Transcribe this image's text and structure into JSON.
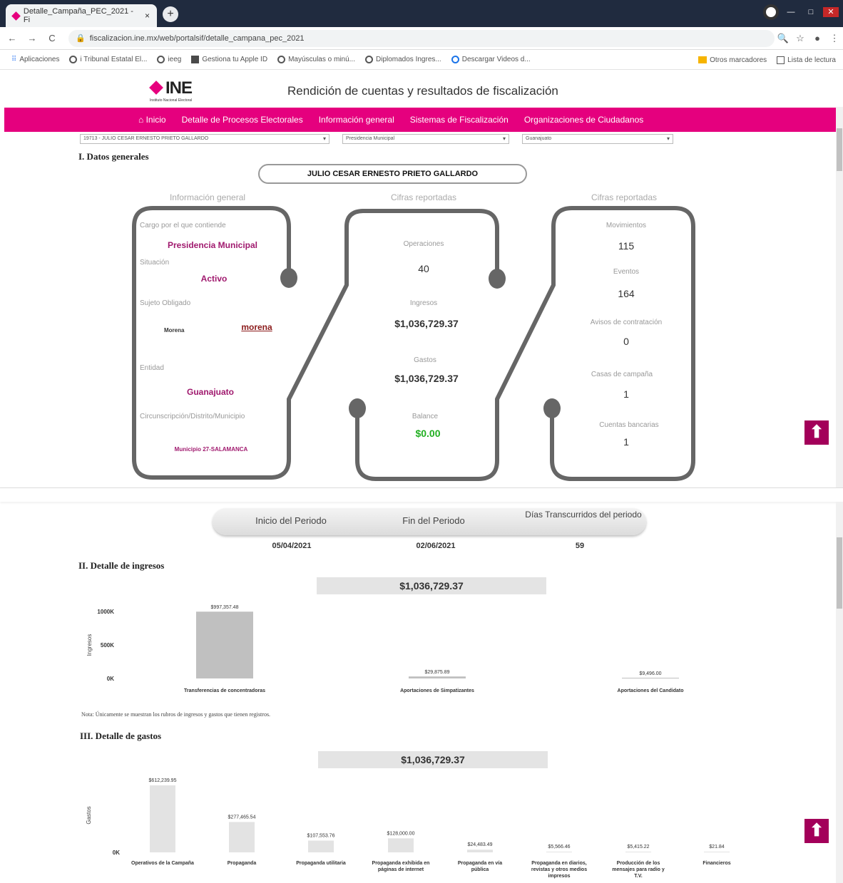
{
  "browser": {
    "tab_title": "Detalle_Campaña_PEC_2021 - Fi",
    "tab_close": "×",
    "new_tab": "+",
    "url": "fiscalizacion.ine.mx/web/portalsif/detalle_campana_pec_2021",
    "nav_back": "←",
    "nav_forward": "→",
    "nav_reload": "C",
    "bookmarks": [
      "Aplicaciones",
      "i Tribunal Estatal El...",
      "ieeg",
      "Gestiona tu Apple ID",
      "Mayúsculas o minú...",
      "Diplomados Ingres...",
      "Descargar Videos d..."
    ],
    "bookmarks_right": [
      "Otros marcadores",
      "Lista de lectura"
    ]
  },
  "site": {
    "logo_text": "INE",
    "logo_sub": "Instituto Nacional Electoral",
    "title": "Rendición de cuentas y resultados de fiscalización",
    "menu": [
      "Inicio",
      "Detalle de Procesos Electorales",
      "Información general",
      "Sistemas de Fiscalización",
      "Organizaciones de Ciudadanos"
    ],
    "selects": [
      "19713 - JULIO CESAR ERNESTO PRIETO GALLARDO",
      "Presidencia Municipal",
      "Guanajuato"
    ]
  },
  "general": {
    "section_title": "I. Datos generales",
    "candidate": "JULIO CESAR ERNESTO PRIETO GALLARDO",
    "col1_title": "Información general",
    "col2_title": "Cifras reportadas",
    "col3_title": "Cifras reportadas",
    "cargo_label": "Cargo por el que contiende",
    "cargo": "Presidencia Municipal",
    "situacion_label": "Situación",
    "situacion": "Activo",
    "sujeto_label": "Sujeto Obligado",
    "sujeto": "Morena",
    "party_logo": "morena",
    "entidad_label": "Entidad",
    "entidad": "Guanajuato",
    "circ_label": "Circunscripción/Distrito/Municipio",
    "circ": "Municipio 27-SALAMANCA",
    "operaciones_label": "Operaciones",
    "operaciones": "40",
    "ingresos_label": "Ingresos",
    "ingresos": "$1,036,729.37",
    "gastos_label": "Gastos",
    "gastos": "$1,036,729.37",
    "balance_label": "Balance",
    "balance": "$0.00",
    "movimientos_label": "Movimientos",
    "movimientos": "115",
    "eventos_label": "Eventos",
    "eventos": "164",
    "avisos_label": "Avisos de contratación",
    "avisos": "0",
    "casas_label": "Casas de campaña",
    "casas": "1",
    "cuentas_label": "Cuentas bancarias",
    "cuentas": "1",
    "colors": {
      "brand": "#e5007e",
      "pink_text": "#a0196e",
      "balance": "#22b022",
      "up_button": "#a3005a"
    }
  },
  "period": {
    "inicio_label": "Inicio del Periodo",
    "fin_label": "Fin del Periodo",
    "dias_label": "Días Transcurridos del periodo",
    "inicio": "05/04/2021",
    "fin": "02/06/2021",
    "dias": "59"
  },
  "ingresos_section": {
    "title": "II. Detalle de ingresos",
    "total": "$1,036,729.37",
    "note": "Nota: Únicamente se muestran los rubros de ingresos y gastos que tienen registros."
  },
  "gastos_section": {
    "title": "III. Detalle de gastos",
    "total": "$1,036,729.37"
  },
  "chart_data": [
    {
      "type": "bar",
      "ylabel": "Ingresos",
      "yticks": [
        "1000K",
        "500K",
        "0K"
      ],
      "ylim": [
        0,
        1000000
      ],
      "categories": [
        "Transferencias de concentradoras",
        "Aportaciones de Simpatizantes",
        "Aportaciones del Candidato"
      ],
      "values": [
        997357.48,
        29875.89,
        9496.0
      ],
      "data_labels": [
        "$997,357.48",
        "$29,875.89",
        "$9,496.00"
      ],
      "color": "#c0c0c0"
    },
    {
      "type": "bar",
      "ylabel": "Gastos",
      "yticks": [
        "0K"
      ],
      "ylim": [
        0,
        612239.95
      ],
      "categories": [
        "Operativos de la Campaña",
        "Propaganda",
        "Propaganda utilitaria",
        "Propaganda exhibida en páginas de internet",
        "Propaganda en vía pública",
        "Propaganda en diarios, revistas y otros medios impresos",
        "Producción de los mensajes para radio y T.V.",
        "Financieros"
      ],
      "values": [
        612239.95,
        277465.54,
        107553.76,
        128000.0,
        24483.49,
        5566.46,
        5415.22,
        21.84
      ],
      "data_labels": [
        "$612,239.95",
        "$277,465.54",
        "$107,553.76",
        "$128,000.00",
        "$24,483.49",
        "$5,566.46",
        "$5,415.22",
        "$21.84"
      ],
      "color": "#e3e3e3"
    }
  ]
}
